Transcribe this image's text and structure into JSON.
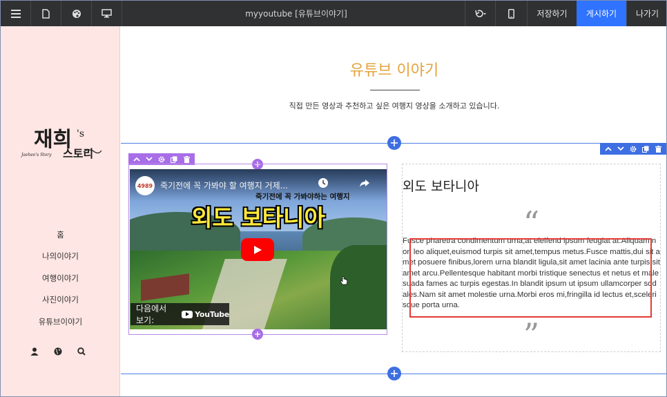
{
  "toolbar": {
    "title": "myyoutube [유튜브이야기]",
    "save_label": "저장하기",
    "publish_label": "게시하기",
    "exit_label": "나가기",
    "publish_color": "#2f73ff",
    "icons": [
      "menu-icon",
      "page-icon",
      "palette-icon",
      "monitor-icon",
      "undo-icon",
      "mobile-icon"
    ]
  },
  "sidebar": {
    "background": "#fde6e3",
    "logo_text": "재희's 스토리",
    "logo_subtext": "Jaehee's Story",
    "nav": [
      "홈",
      "나의이야기",
      "여행이야기",
      "사진이야기",
      "유튜브이야기"
    ],
    "icons": [
      "user-icon",
      "globe-icon",
      "search-icon"
    ]
  },
  "section": {
    "title": "유튜브 이야기",
    "title_color": "#e4a33d",
    "subtitle": "직접 만든 영상과 추천하고 싶은 여행지 영상을 소개하고 있습니다."
  },
  "video": {
    "channel_badge": "4989",
    "yt_title": "죽기전에 꼭 가봐야 할 여행지 거제...",
    "overlay_title": "죽기전에 꼭 가봐야하는 여행지",
    "caption": "외도 보타니아",
    "watch_label": "다음에서 보기:",
    "yt_logo_text": "YouTube"
  },
  "text_block": {
    "heading": "외도 보타니아",
    "quote_open": "“",
    "quote_close": "”",
    "body": "Fusce pharetra condimentum urna,at eleifend ipsum feugiat at.Aliquam non leo aliquet,euismod turpis sit amet,tempus metus.Fusce mattis,dui sit amet posuere finibus,lorem urna blandit ligula,sit amet lacinia ante turpis sit amet arcu.Pellentesque habitant morbi tristique senectus et netus et malesuada fames ac turpis egestas.In blandit ipsum ut ipsum ullamcorper sodales.Nam sit amet molestie urna.Morbi eros mi,fringilla id lectus et,scelerisque porta urna."
  },
  "editor": {
    "add_icon": "plus-icon",
    "block_controls": [
      "move-up-icon",
      "move-down-icon",
      "settings-icon",
      "copy-icon",
      "delete-icon"
    ],
    "section_line_color": "#4c7ee6",
    "block_accent_color": "#a86de8",
    "selection_color": "#e23a35"
  }
}
